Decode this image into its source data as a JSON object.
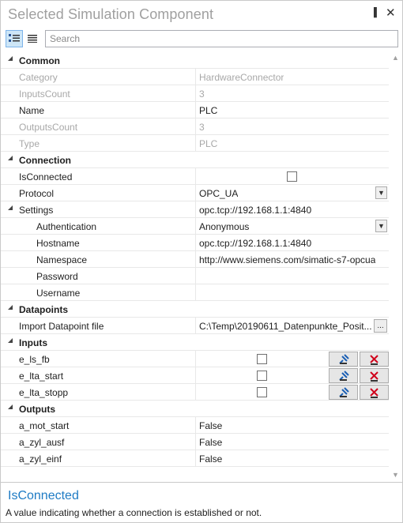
{
  "window": {
    "title": "Selected Simulation Component",
    "pin_glyph": "▐",
    "close_glyph": "✕"
  },
  "toolbar": {
    "search_placeholder": "Search"
  },
  "categories": {
    "common": "Common",
    "connection": "Connection",
    "datapoints": "Datapoints",
    "inputs": "Inputs",
    "outputs": "Outputs"
  },
  "common": {
    "category": {
      "name": "Category",
      "value": "HardwareConnector"
    },
    "inputs_count": {
      "name": "InputsCount",
      "value": "3"
    },
    "name": {
      "name": "Name",
      "value": "PLC"
    },
    "outputs_count": {
      "name": "OutputsCount",
      "value": "3"
    },
    "type": {
      "name": "Type",
      "value": "PLC"
    }
  },
  "connection": {
    "is_connected": {
      "name": "IsConnected",
      "checked": false
    },
    "protocol": {
      "name": "Protocol",
      "value": "OPC_UA"
    },
    "settings": {
      "name": "Settings",
      "value": "opc.tcp://192.168.1.1:4840"
    },
    "authentication": {
      "name": "Authentication",
      "value": "Anonymous"
    },
    "hostname": {
      "name": "Hostname",
      "value": "opc.tcp://192.168.1.1:4840"
    },
    "namespace": {
      "name": "Namespace",
      "value": "http://www.siemens.com/simatic-s7-opcua"
    },
    "password": {
      "name": "Password",
      "value": ""
    },
    "username": {
      "name": "Username",
      "value": ""
    }
  },
  "datapoints": {
    "import": {
      "name": "Import Datapoint file",
      "value": "C:\\Temp\\20190611_Datenpunkte_Posit...",
      "button": "..."
    }
  },
  "inputs": [
    {
      "name": "e_ls_fb",
      "checked": false
    },
    {
      "name": "e_lta_start",
      "checked": false
    },
    {
      "name": "e_lta_stopp",
      "checked": false
    }
  ],
  "outputs": [
    {
      "name": "a_mot_start",
      "value": "False"
    },
    {
      "name": "a_zyl_ausf",
      "value": "False"
    },
    {
      "name": "a_zyl_einf",
      "value": "False"
    }
  ],
  "description": {
    "title": "IsConnected",
    "text": "A value indicating whether a connection is established or not."
  },
  "colors": {
    "accent": "#1e7bc4",
    "readonly_text": "#a8a8a8",
    "grid_line": "#e8e8e8"
  }
}
